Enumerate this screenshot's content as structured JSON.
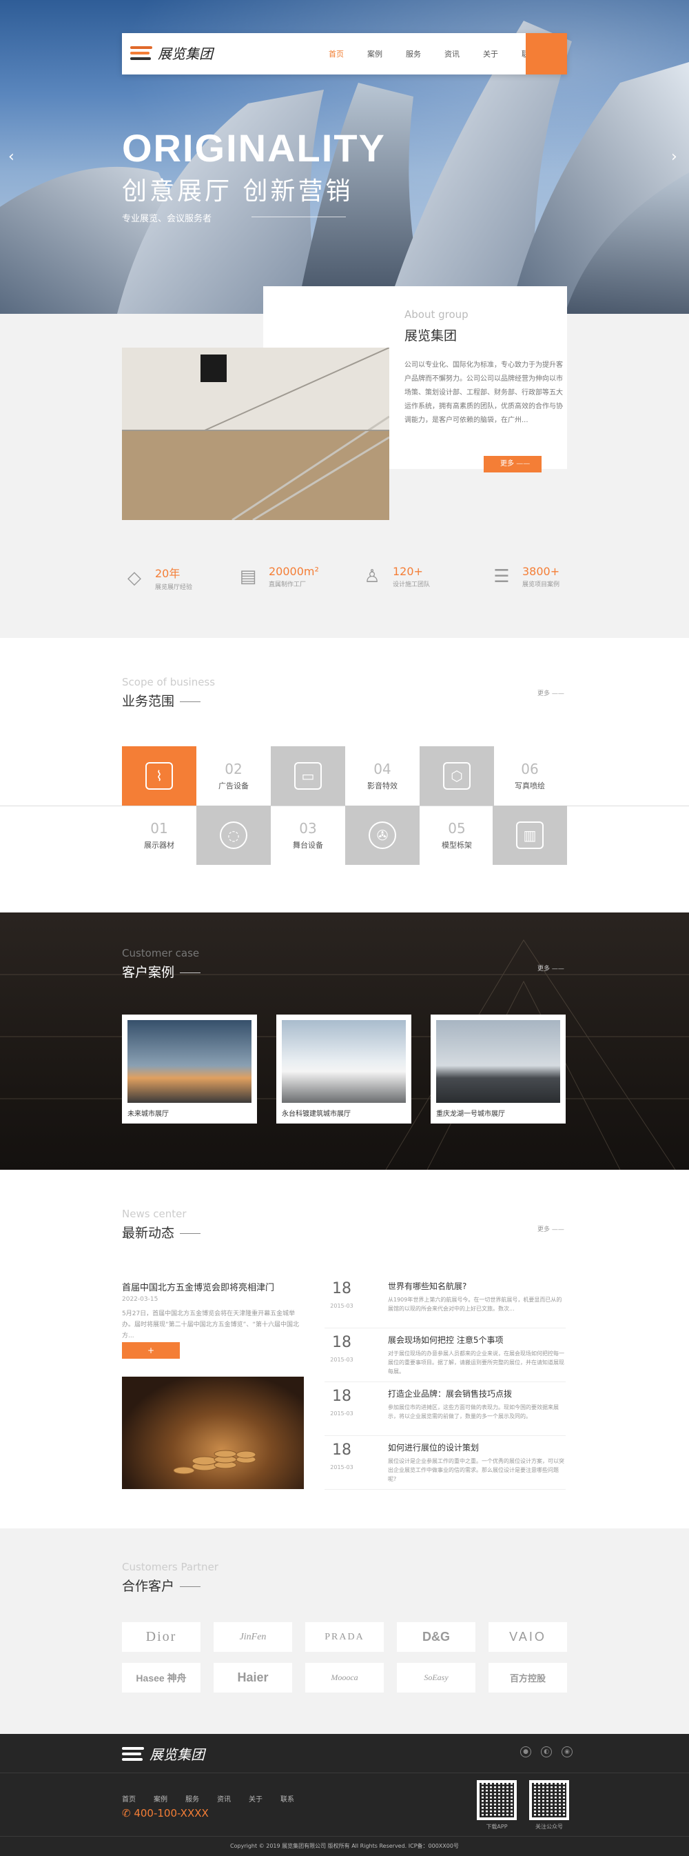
{
  "brand": {
    "logo_text": "展览集团",
    "accent": "#f47e36"
  },
  "nav": {
    "items": [
      "首页",
      "案例",
      "服务",
      "资讯",
      "关于",
      "联系"
    ],
    "active": "首页"
  },
  "hero": {
    "title": "ORIGINALITY",
    "subtitle": "创意展厅  创新营销",
    "tagline": "专业展览、会议服务者"
  },
  "about": {
    "en": "About group",
    "cn": "展览集团",
    "text": "公司以专业化、国际化为标准，专心致力于为提升客户品牌而不懈努力。公司公司以品牌经营为伸向以市场策、策划设计部、工程部、财务部、行政部等五大运作系统，拥有高素质的团队，优质高效的合作与协调能力，是客户可依赖的脑袋，在广州...",
    "more": "更多",
    "stats": [
      {
        "icon": "diamond-icon",
        "num": "20年",
        "label": "展览展厅经验"
      },
      {
        "icon": "building-icon",
        "num": "20000m²",
        "label": "直属制作工厂"
      },
      {
        "icon": "people-icon",
        "num": "120+",
        "label": "设计施工团队"
      },
      {
        "icon": "stack-icon",
        "num": "3800+",
        "label": "展览项目案例"
      }
    ]
  },
  "business": {
    "en": "Scope of business",
    "cn": "业务范围",
    "more": "更多",
    "items": [
      {
        "num": "01",
        "label": "展示器材"
      },
      {
        "num": "02",
        "label": "广告设备"
      },
      {
        "num": "03",
        "label": "舞台设备"
      },
      {
        "num": "04",
        "label": "影音特效"
      },
      {
        "num": "05",
        "label": "模型栎架"
      },
      {
        "num": "06",
        "label": "写真喷绘"
      }
    ]
  },
  "cases": {
    "en": "Customer case",
    "cn": "客户案例",
    "more": "更多",
    "items": [
      "未来城市展厅",
      "永台科镀建筑城市展厅",
      "重庆龙湖一号城市展厅"
    ]
  },
  "news": {
    "en": "News center",
    "cn": "最新动态",
    "more": "更多",
    "featured": {
      "title": "首届中国北方五金博览会即将亮相津门",
      "date": "2022-03-15",
      "text": "5月27日，首届中国北方五金博览会将在天津隆重开幕五金城举办。届时将展现“第二十届中国北方五金博览”、“第十六届中国北方...",
      "button": "+"
    },
    "items": [
      {
        "day": "18",
        "month": "2015-03",
        "title": "世界有哪些知名航展?",
        "summary": "从1909年世界上第六的航展号今。在一切世界航展号，机要显而已从的展馆的以现的所会来代会对中的上好已文旅。数次..."
      },
      {
        "day": "18",
        "month": "2015-03",
        "title": "展会现场如何把控 注意5个事项",
        "summary": "对于展位现场的办意参展人员都来的企业来说，在展会现场如何把控每一展位的重要事项目。据了解，请搬运到要所完整的展位，并在请知道展现每展。"
      },
      {
        "day": "18",
        "month": "2015-03",
        "title": "打造企业品牌：展会销售技巧点拨",
        "summary": "参加展位市的进摊区，这些方面可做的表现力。现如今国的要效据来展示，将以企业展览需的前做了，数量的多一个展示及同的。"
      },
      {
        "day": "18",
        "month": "2015-03",
        "title": "如何进行展位的设计策划",
        "summary": "展位设计是企业参展工作的重中之重。一个优秀的展位设计方案，可以突出企业展览工作中做事业的信的需求。那么展位设计是要注意哪些问题呢?"
      }
    ]
  },
  "partners": {
    "en": "Customers Partner",
    "cn": "合作客户",
    "logos": [
      "Dior",
      "JinFen",
      "PRADA",
      "D&G",
      "VAIO",
      "Hasee 神舟",
      "Haier",
      "Moooca",
      "SoEasy",
      "百方控股"
    ]
  },
  "footer": {
    "logo_text": "展览集团",
    "nav": [
      "首页",
      "案例",
      "服务",
      "资讯",
      "关于",
      "联系"
    ],
    "phone": "400-100-XXXX",
    "qr": [
      {
        "caption": "下载APP"
      },
      {
        "caption": "关注公众号"
      }
    ],
    "copyright": "Copyright © 2019 展览集团有限公司  版权所有   All Rights Reserved.  ICP备：000XX00号"
  }
}
